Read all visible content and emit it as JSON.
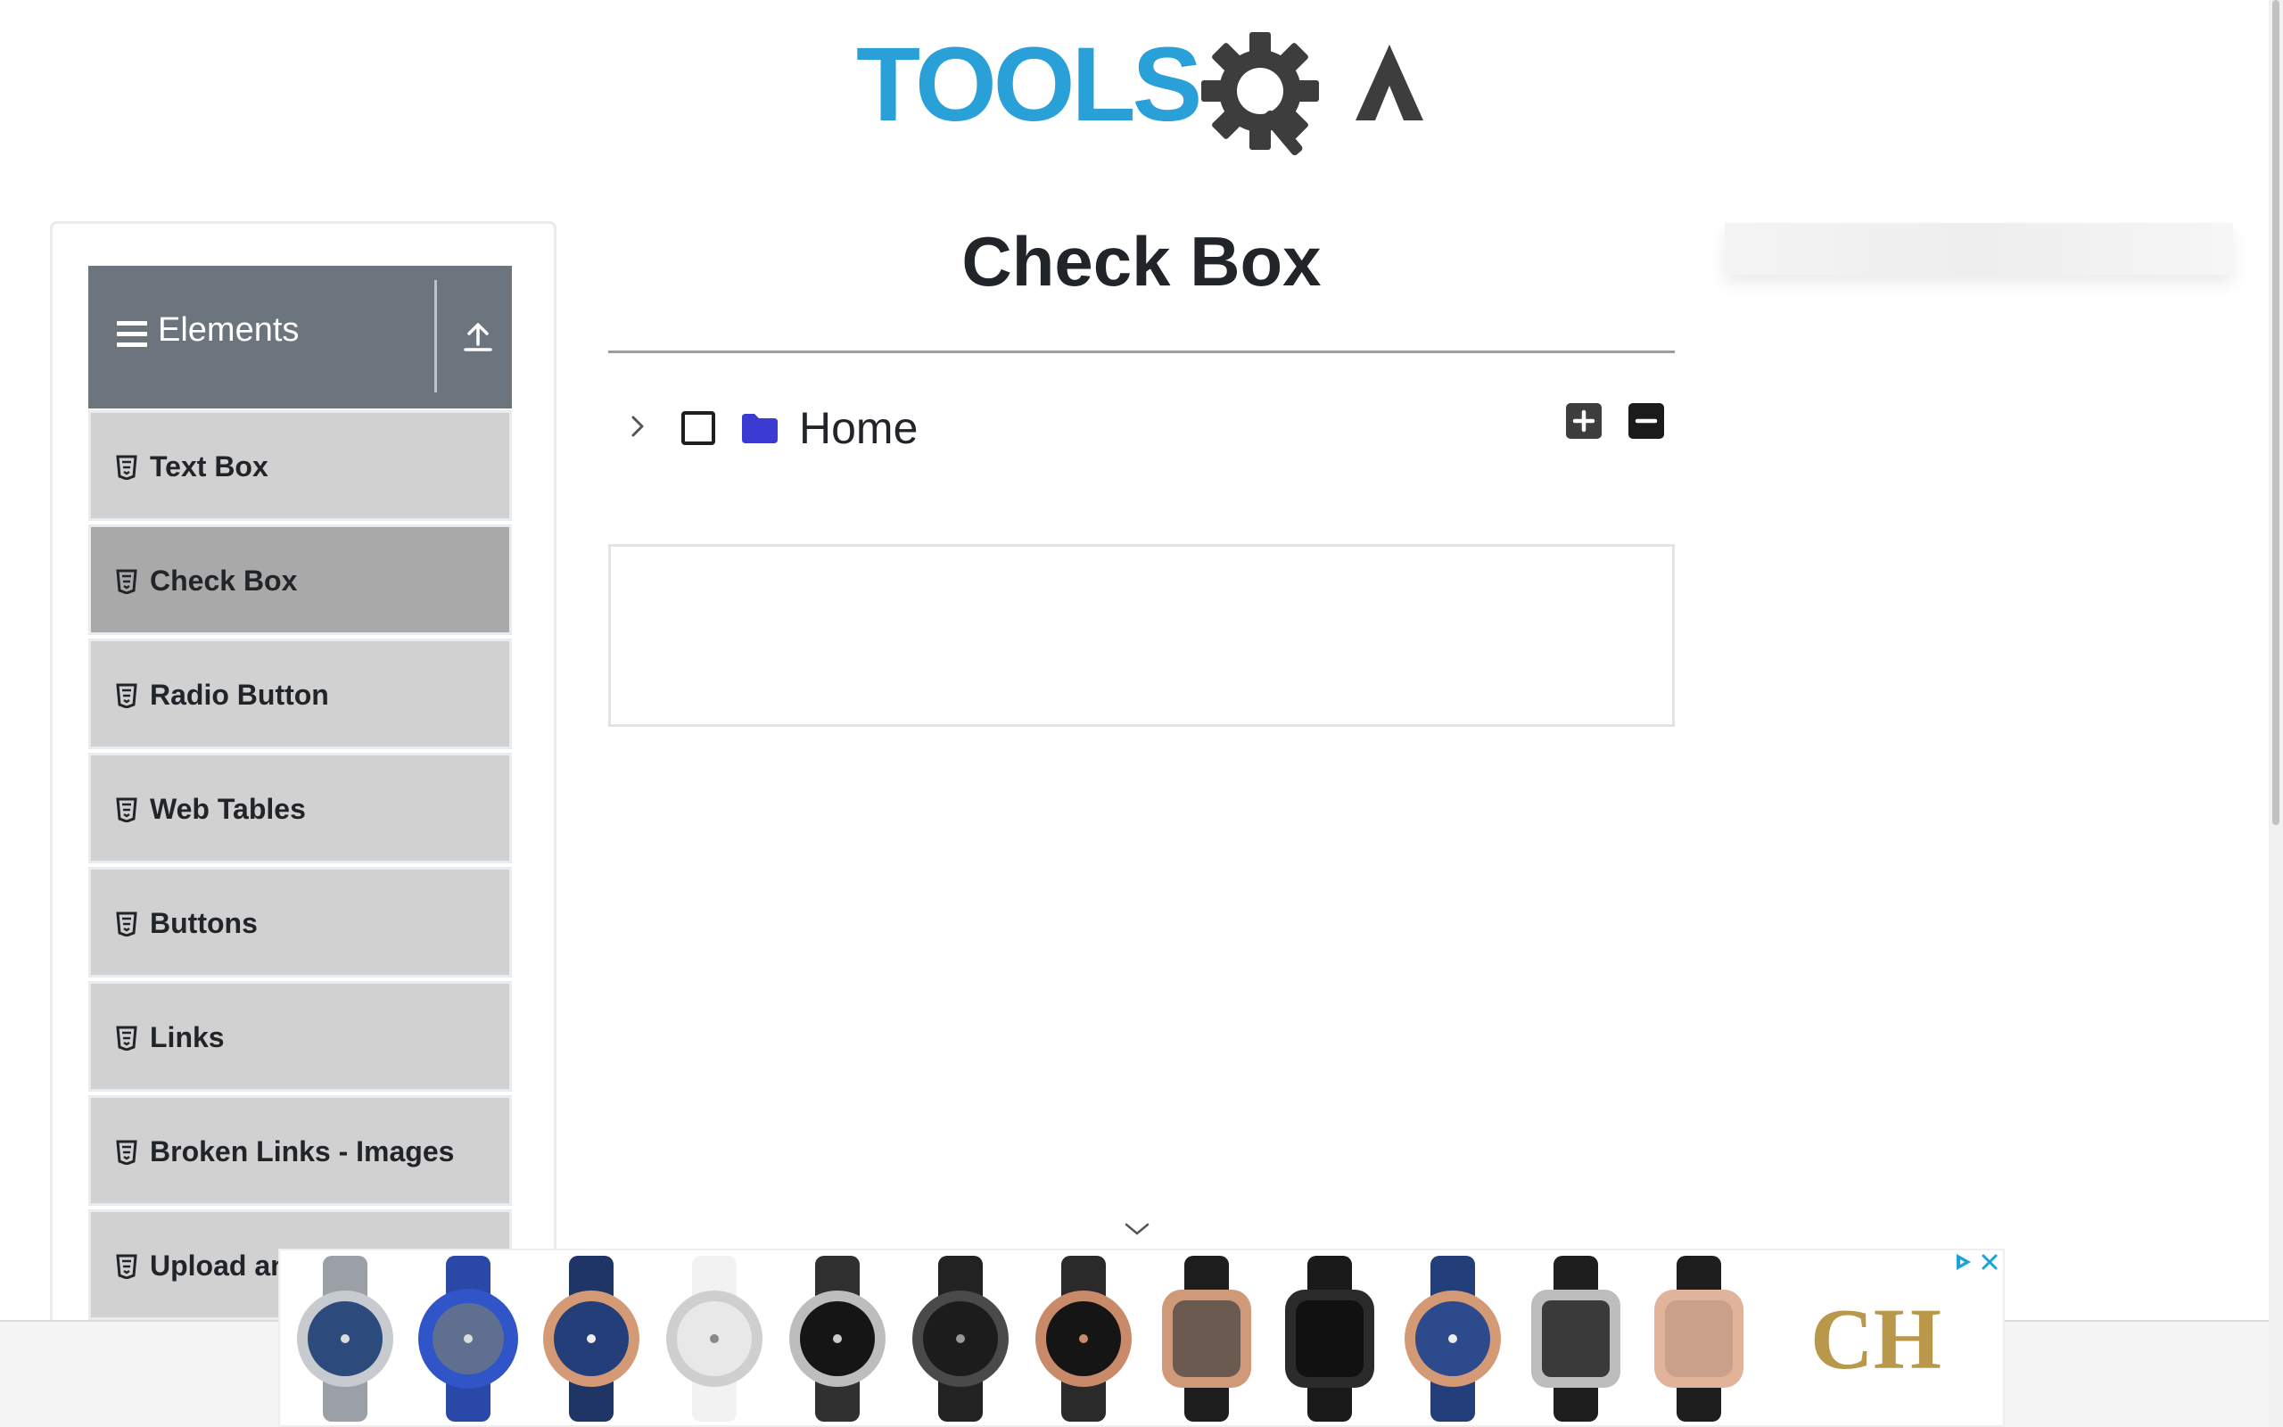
{
  "header": {
    "logo_text": "TOOLSQA",
    "logo_colors": {
      "tools": "#2aa0d8",
      "qa": "#3d3d3d"
    }
  },
  "sidebar": {
    "group_title": "Elements",
    "items": [
      {
        "label": "Text Box",
        "active": false
      },
      {
        "label": "Check Box",
        "active": true
      },
      {
        "label": "Radio Button",
        "active": false
      },
      {
        "label": "Web Tables",
        "active": false
      },
      {
        "label": "Buttons",
        "active": false
      },
      {
        "label": "Links",
        "active": false
      },
      {
        "label": "Broken Links - Images",
        "active": false
      },
      {
        "label": "Upload and Download",
        "active": false
      }
    ],
    "colors": {
      "header_bg": "#6c757d",
      "item_bg": "#d1d1d1",
      "active_bg": "#a9a9a9"
    }
  },
  "main": {
    "title": "Check Box",
    "tree": {
      "root_label": "Home",
      "checked": false,
      "expanded": false,
      "folder_color": "#3b3bd4"
    },
    "buttons": {
      "expand_all_icon": "plus-square-icon",
      "collapse_all_icon": "minus-square-icon"
    }
  },
  "ads": {
    "brand_text": "CH",
    "brand_color": "#b9974b",
    "watch_count": 12,
    "close_icon": "close-icon",
    "adchoices_icon": "adchoices-icon"
  }
}
